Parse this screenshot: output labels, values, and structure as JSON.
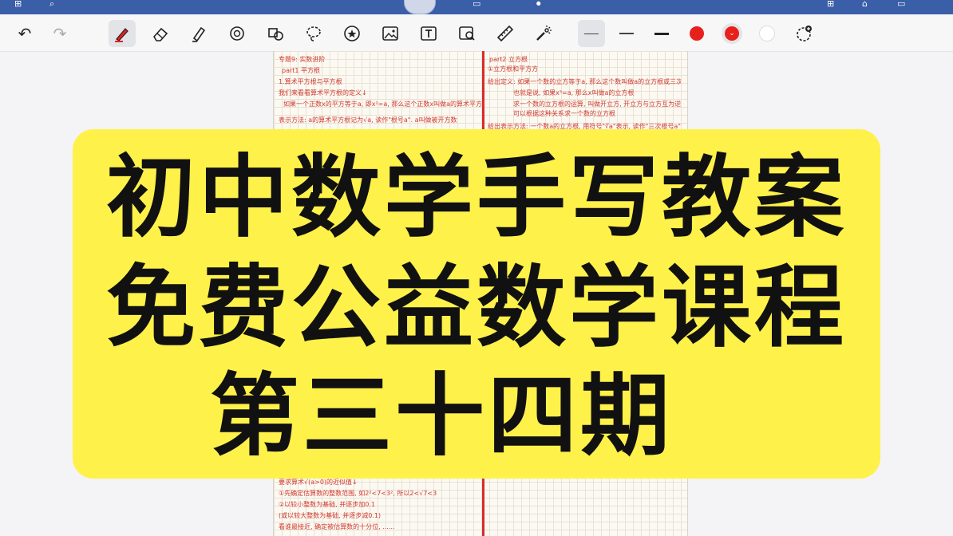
{
  "system_bar": {
    "color": "#3a5ea8"
  },
  "toolbar": {
    "undo_icon": "undo-icon",
    "redo_icon": "redo-icon",
    "tools": [
      "pen-icon",
      "eraser-icon",
      "highlighter-icon",
      "shape-icon",
      "lasso-fill-icon",
      "lasso-icon",
      "sticker-icon",
      "image-icon",
      "text-icon",
      "image-search-icon",
      "ruler-icon",
      "laser-pointer-icon"
    ],
    "stroke_widths": [
      "thin",
      "medium",
      "thick"
    ],
    "colors": [
      "#e8201c",
      "#e8201c",
      "#ffffff"
    ],
    "active_color": "#e8201c"
  },
  "page": {
    "left_notes": [
      "专题9: 实数进阶",
      "part1 平方根",
      "1.算术平方根与平方根",
      "我们来看看算术平方根的定义↓",
      "如果一个正数x的平方等于a, 即x²=a, 那么这个正数x叫做a的算术平方根",
      "表示方法: a的算术平方根记为√a, 读作\"根号a\". a叫做被开方数",
      "要求算术√(a>0)的近似值↓",
      "①先确定估算数的整数范围, 如2²<7<3², 所以2<√7<3",
      "②以较小整数为基础, 并逐步加0.1",
      "(或以较大整数为基础, 并逐步减0.1)",
      "看谁最接近, 确定被估算数的十分位, ......"
    ],
    "right_notes": [
      "part2 立方根",
      "①立方根和平方方",
      "给出定义: 如果一个数的立方等于a, 那么这个数叫做a的立方根或三次方根",
      "也就是说, 如果x³=a, 那么x叫做a的立方根",
      "求一个数的立方根的运算, 叫做开立方, 开立方与立方互为逆运算",
      "可以根据这种关系求一个数的立方根",
      "给出表示方法: 一个数a的立方根, 用符号\"∛a\"表示, 读作\"三次根号a\""
    ]
  },
  "banner": {
    "color": "#fef14a",
    "line1": "初中数学手写教案",
    "line2": "免费公益数学课程",
    "line3": "第三十四期"
  }
}
